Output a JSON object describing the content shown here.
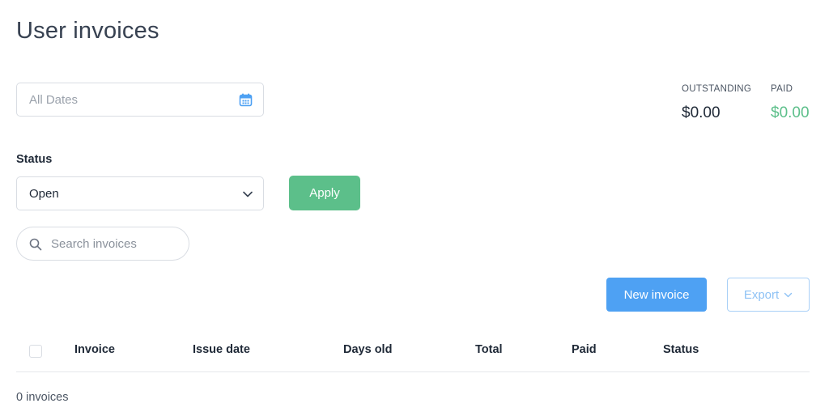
{
  "page": {
    "title": "User invoices"
  },
  "filters": {
    "date_placeholder": "All Dates",
    "status_label": "Status",
    "status_value": "Open",
    "apply_label": "Apply",
    "search_placeholder": "Search invoices"
  },
  "summary": {
    "outstanding": {
      "label": "OUTSTANDING",
      "amount": "$0.00"
    },
    "paid": {
      "label": "PAID",
      "amount": "$0.00"
    }
  },
  "actions": {
    "new_invoice_label": "New invoice",
    "export_label": "Export"
  },
  "table": {
    "columns": [
      "Invoice",
      "Issue date",
      "Days old",
      "Total",
      "Paid",
      "Status"
    ],
    "rows": []
  },
  "footer": {
    "count_text": "0 invoices"
  },
  "icons": {
    "date": "calendar-icon",
    "status": "chevron-down-icon",
    "search": "search-icon",
    "export": "chevron-down-icon"
  },
  "colors": {
    "primary": "#4ea1f3",
    "success": "#5cbf8a",
    "border": "#d9dde3"
  }
}
